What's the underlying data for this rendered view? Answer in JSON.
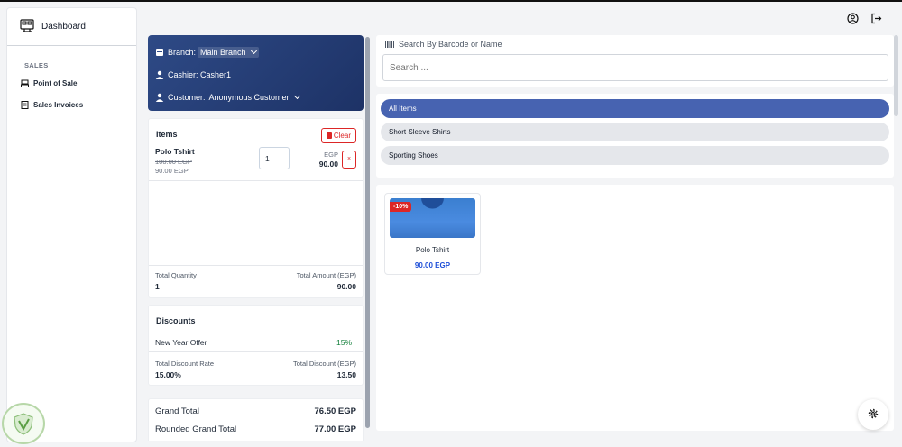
{
  "sidebar": {
    "title": "Dashboard",
    "section": "SALES",
    "items": [
      {
        "label": "Point of Sale"
      },
      {
        "label": "Sales Invoices"
      }
    ]
  },
  "header": {
    "icons": [
      "user-circle-icon",
      "logout-icon"
    ]
  },
  "cart": {
    "branch_label": "Branch:",
    "branch_value": "Main Branch",
    "cashier": "Cashier: Casher1",
    "customer_label": "Customer:",
    "customer_value": "Anonymous Customer",
    "items_title": "Items",
    "clear_label": "Clear",
    "items": [
      {
        "name": "Polo Tshirt",
        "old_price": "100.00 EGP",
        "new_price": "90.00 EGP",
        "qty": "1",
        "currency": "EGP",
        "total": "90.00",
        "remove": "×"
      }
    ],
    "total_quantity_label": "Total Quantity",
    "total_quantity": "1",
    "total_amount_label": "Total Amount (EGP)",
    "total_amount": "90.00",
    "discounts_title": "Discounts",
    "offer_name": "New Year Offer",
    "offer_rate": "15%",
    "total_discount_rate_label": "Total Discount Rate",
    "total_discount_rate": "15.00%",
    "total_discount_label": "Total Discount (EGP)",
    "total_discount": "13.50",
    "grand_total_label": "Grand Total",
    "grand_total": "76.50 EGP",
    "rounded_label": "Rounded Grand Total",
    "rounded_value": "77.00 EGP"
  },
  "search": {
    "label": "Search By Barcode or Name",
    "placeholder": "Search ..."
  },
  "categories": [
    {
      "label": "All Items",
      "active": true
    },
    {
      "label": "Short Sleeve Shirts",
      "active": false
    },
    {
      "label": "Sporting Shoes",
      "active": false
    }
  ],
  "products": [
    {
      "name": "Polo Tshirt",
      "price": "90.00 EGP",
      "badge": "-10%"
    }
  ],
  "colors": {
    "header_gradient": "#2e4a86",
    "active_category": "#4763b1",
    "danger": "#dc2626",
    "discount_green": "#15803d",
    "price_blue": "#1d4ed8"
  }
}
